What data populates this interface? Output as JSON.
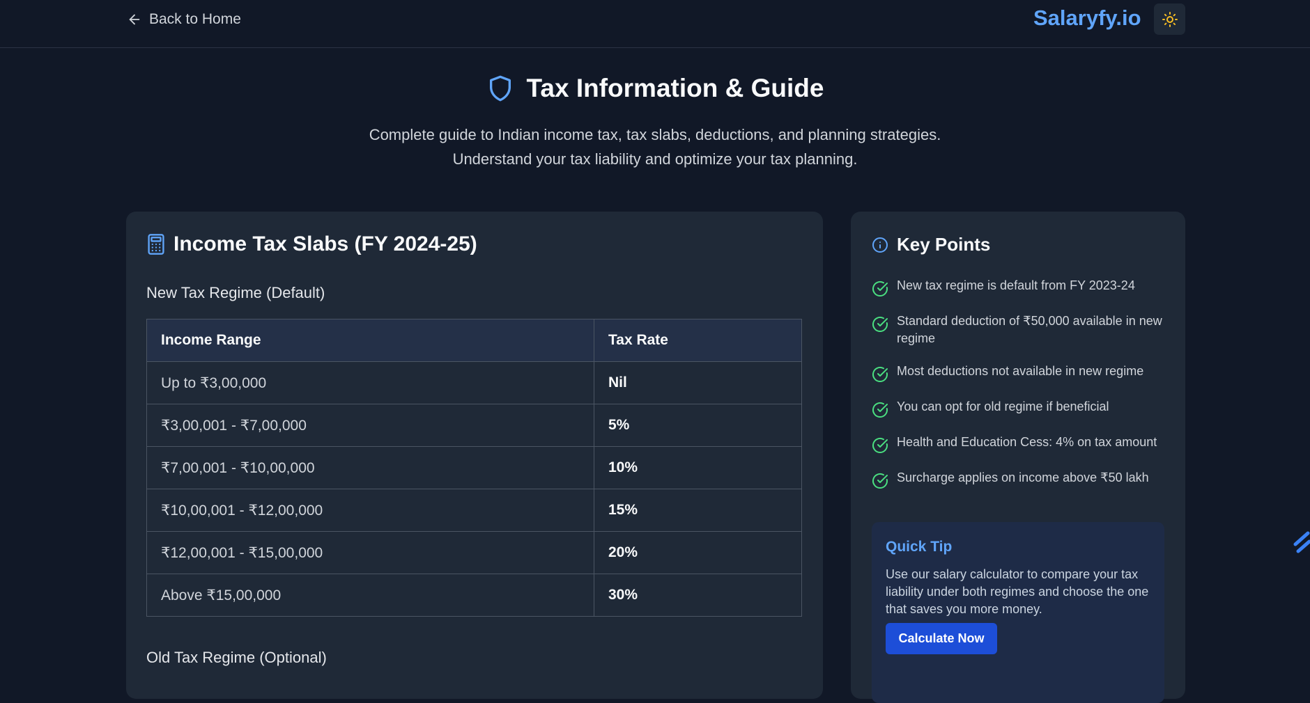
{
  "header": {
    "back_label": "Back to Home",
    "brand": "Salaryfy.io"
  },
  "hero": {
    "title": "Tax Information & Guide",
    "subtitle_line1": "Complete guide to Indian income tax, tax slabs, deductions, and planning strategies.",
    "subtitle_line2": "Understand your tax liability and optimize your tax planning."
  },
  "slabs": {
    "title": "Income Tax Slabs (FY 2024-25)",
    "new_regime_heading": "New Tax Regime (Default)",
    "columns": [
      "Income Range",
      "Tax Rate"
    ],
    "rows": [
      [
        "Up to ₹3,00,000",
        "Nil"
      ],
      [
        "₹3,00,001 - ₹7,00,000",
        "5%"
      ],
      [
        "₹7,00,001 - ₹10,00,000",
        "10%"
      ],
      [
        "₹10,00,001 - ₹12,00,000",
        "15%"
      ],
      [
        "₹12,00,001 - ₹15,00,000",
        "20%"
      ],
      [
        "Above ₹15,00,000",
        "30%"
      ]
    ],
    "old_regime_heading": "Old Tax Regime (Optional)"
  },
  "key_points": {
    "title": "Key Points",
    "items": [
      "New tax regime is default from FY 2023-24",
      "Standard deduction of ₹50,000 available in new regime",
      "Most deductions not available in new regime",
      "You can opt for old regime if beneficial",
      "Health and Education Cess: 4% on tax amount",
      "Surcharge applies on income above ₹50 lakh"
    ]
  },
  "tip": {
    "title": "Quick Tip",
    "text": "Use our salary calculator to compare your tax liability under both regimes and choose the one that saves you more money.",
    "button": "Calculate Now"
  },
  "colors": {
    "background": "#111827",
    "card": "#1f2937",
    "accent": "#60a5fa",
    "check": "#4ade80",
    "sun": "#fbbf24",
    "button": "#1d4ed8"
  }
}
